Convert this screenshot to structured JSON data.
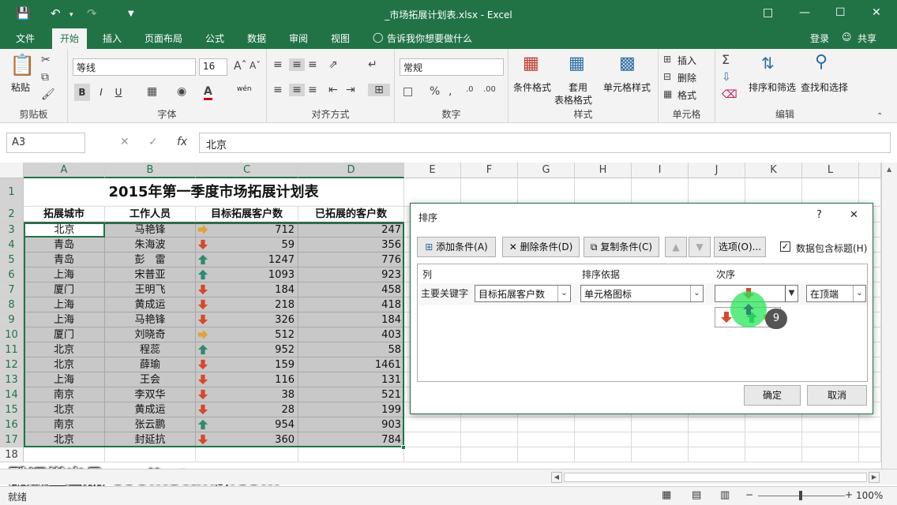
{
  "window": {
    "title": "_市场拓展计划表.xlsx - Excel"
  },
  "tabs": [
    "文件",
    "开始",
    "插入",
    "页面布局",
    "公式",
    "数据",
    "审阅",
    "视图"
  ],
  "tell_me": "告诉我你想要做什么",
  "account": {
    "login": "登录",
    "share": "共享"
  },
  "ribbon": {
    "clipboard": {
      "paste": "粘贴",
      "label": "剪贴板"
    },
    "font": {
      "name": "等线",
      "size": "16",
      "bold": "B",
      "italic": "I",
      "underline": "U",
      "wen": "wén",
      "label": "字体"
    },
    "alignment": {
      "label": "对齐方式"
    },
    "number": {
      "format": "常规",
      "label": "数字"
    },
    "styles": {
      "cond_format": "条件格式",
      "table_format_1": "套用",
      "table_format_2": "表格格式",
      "cell_style": "单元格样式",
      "label": "样式"
    },
    "cells": {
      "insert": "插入",
      "delete": "删除",
      "format": "格式",
      "label": "单元格"
    },
    "editing": {
      "sort_filter": "排序和筛选",
      "find_select": "查找和选择",
      "label": "编辑"
    }
  },
  "formula_bar": {
    "name_box": "A3",
    "value": "北京"
  },
  "columns": [
    "A",
    "B",
    "C",
    "D",
    "E",
    "F",
    "G",
    "H",
    "I",
    "J",
    "K",
    "L"
  ],
  "sheet": {
    "title": "2015年第一季度市场拓展计划表",
    "headers": [
      "拓展城市",
      "工作人员",
      "目标拓展客户数",
      "已拓展的客户数"
    ],
    "rows": [
      {
        "n": "3",
        "city": "北京",
        "person": "马艳锋",
        "target": "712",
        "done": "247",
        "icon": "right"
      },
      {
        "n": "4",
        "city": "青岛",
        "person": "朱海波",
        "target": "59",
        "done": "356",
        "icon": "down"
      },
      {
        "n": "5",
        "city": "青岛",
        "person": "彭　雷",
        "target": "1247",
        "done": "776",
        "icon": "up"
      },
      {
        "n": "6",
        "city": "上海",
        "person": "宋普亚",
        "target": "1093",
        "done": "923",
        "icon": "up"
      },
      {
        "n": "7",
        "city": "厦门",
        "person": "王明飞",
        "target": "184",
        "done": "458",
        "icon": "down"
      },
      {
        "n": "8",
        "city": "上海",
        "person": "黄成运",
        "target": "218",
        "done": "418",
        "icon": "down"
      },
      {
        "n": "9",
        "city": "上海",
        "person": "马艳锋",
        "target": "326",
        "done": "184",
        "icon": "down"
      },
      {
        "n": "10",
        "city": "厦门",
        "person": "刘晓奇",
        "target": "512",
        "done": "403",
        "icon": "right"
      },
      {
        "n": "11",
        "city": "北京",
        "person": "程蕊",
        "target": "952",
        "done": "58",
        "icon": "up"
      },
      {
        "n": "12",
        "city": "北京",
        "person": "薛瑜",
        "target": "159",
        "done": "1461",
        "icon": "down"
      },
      {
        "n": "13",
        "city": "上海",
        "person": "王会",
        "target": "116",
        "done": "131",
        "icon": "down"
      },
      {
        "n": "14",
        "city": "南京",
        "person": "李双华",
        "target": "38",
        "done": "521",
        "icon": "down"
      },
      {
        "n": "15",
        "city": "北京",
        "person": "黄成运",
        "target": "28",
        "done": "199",
        "icon": "down"
      },
      {
        "n": "16",
        "city": "南京",
        "person": "张云鹏",
        "target": "954",
        "done": "903",
        "icon": "up"
      },
      {
        "n": "17",
        "city": "北京",
        "person": "封延抗",
        "target": "360",
        "done": "784",
        "icon": "down"
      }
    ],
    "extra_rows": [
      "18"
    ]
  },
  "dialog": {
    "title": "排序",
    "help": "?",
    "close": "✕",
    "add_level": "添加条件(A)",
    "delete_level": "删除条件(D)",
    "copy_level": "复制条件(C)",
    "options": "选项(O)...",
    "has_headers": "数据包含标题(H)",
    "col_header": "列",
    "sort_on_header": "排序依据",
    "order_header": "次序",
    "main_key": "主要关键字",
    "key_value": "目标拓展客户数",
    "sort_on_value": "单元格图标",
    "position_value": "在顶端",
    "ok": "确定",
    "cancel": "取消",
    "badge": "9"
  },
  "watermark": "酷课堂出品 coolketang.com",
  "status": {
    "ready": "就绪",
    "zoom": "100%"
  },
  "colors": {
    "accent": "#217346",
    "up": "#2e8b6e",
    "down": "#d9472b",
    "right": "#e3a13a"
  }
}
